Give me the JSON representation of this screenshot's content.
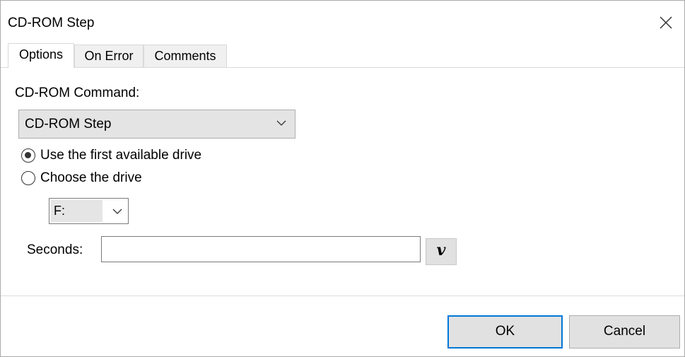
{
  "window": {
    "title": "CD-ROM Step"
  },
  "tabs": [
    {
      "label": "Options"
    },
    {
      "label": "On Error"
    },
    {
      "label": "Comments"
    }
  ],
  "options": {
    "command_label": "CD-ROM Command:",
    "command_value": "CD-ROM Step",
    "radio_first_drive": {
      "label": "Use the first available drive",
      "selected": true
    },
    "radio_choose_drive": {
      "label": "Choose the drive",
      "selected": false
    },
    "drive_value": "F:",
    "seconds_label": "Seconds:",
    "seconds_value": "",
    "variable_button": "v"
  },
  "footer": {
    "ok_label": "OK",
    "cancel_label": "Cancel"
  },
  "icons": {
    "close": "close-icon",
    "chevron": "chevron-down-icon"
  },
  "colors": {
    "accent": "#0078d7",
    "button_bg": "#e1e1e1"
  }
}
